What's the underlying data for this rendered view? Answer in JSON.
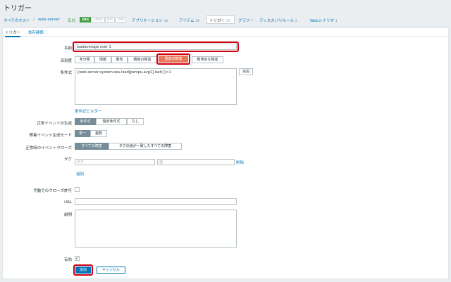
{
  "page": {
    "title": "トリガー"
  },
  "breadcrumb": {
    "all_hosts": "すべてのホスト",
    "sep": "/",
    "host": "web-server",
    "status": "有効",
    "badges": [
      "ZBX",
      "SNMP",
      "JMX",
      "IPMI"
    ],
    "applications": {
      "label": "アプリケーション",
      "count": "10"
    },
    "items": {
      "label": "アイテム",
      "count": "39"
    },
    "triggers": {
      "label": "トリガー",
      "count": "17"
    },
    "graphs": {
      "label": "グラフ",
      "count": "7"
    },
    "discovery": {
      "label": "ディスカバリルール",
      "count": "2"
    },
    "web": {
      "label": "Webシナリオ",
      "count": "1"
    }
  },
  "tabs": [
    "トリガー",
    "依存関係"
  ],
  "form": {
    "name_label": "名前",
    "name_value": "loadaverage over 1",
    "severity_label": "深刻度",
    "severities": [
      "未分類",
      "情報",
      "警告",
      "軽度の障害",
      "重度の障害",
      "致命的な障害"
    ],
    "severity_selected": "重度の障害",
    "expression_label": "条件式",
    "expression_value": "{web-server:system.cpu.load[percpu,avg1].last()}>1",
    "add_label": "追加",
    "expression_builder": "条件式ビルダー",
    "ok_event_label": "正常イベントの生成",
    "ok_event_options": [
      "条件式",
      "復旧条件式",
      "なし"
    ],
    "ok_event_selected": "条件式",
    "problem_mode_label": "障害イベント生成モード",
    "problem_mode_options": [
      "単一",
      "複数"
    ],
    "problem_mode_selected": "単一",
    "ok_close_label": "正常時のイベントクローズ",
    "ok_close_options": [
      "すべての障害",
      "タグの値が一致したすべての障害"
    ],
    "ok_close_selected": "すべての障害",
    "tags_label": "タグ",
    "tag_placeholder": "タグ",
    "value_placeholder": "値",
    "remove_label": "削除",
    "tag_add": "追加",
    "manual_close_label": "手動でのクローズ許可",
    "url_label": "URL",
    "description_label": "説明",
    "enabled_label": "有効",
    "enabled_check": "✓",
    "submit": "追加",
    "cancel": "キャンセル"
  }
}
